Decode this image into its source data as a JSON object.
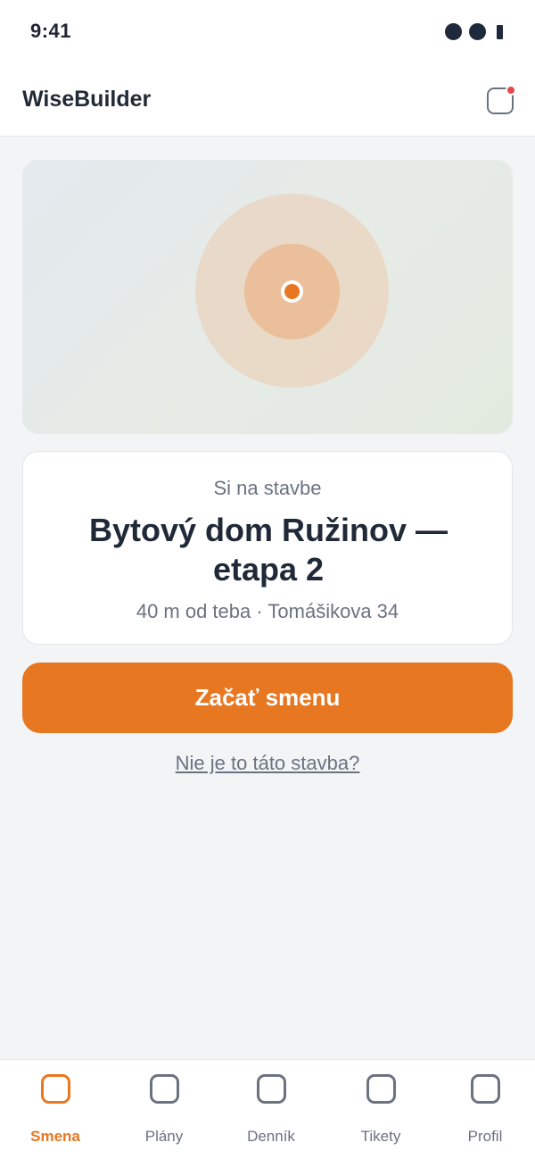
{
  "status_bar": {
    "time": "9:41"
  },
  "header": {
    "title": "WiseBuilder"
  },
  "site_card": {
    "status": "Si na stavbe",
    "name": "Bytový dom Ružinov — etapa 2",
    "meta": "40 m od teba · Tomášikova 34"
  },
  "actions": {
    "start_label": "Začať smenu",
    "wrong_site_label": "Nie je to táto stavba?"
  },
  "nav": {
    "items": [
      {
        "label": "Smena",
        "active": true
      },
      {
        "label": "Plány",
        "active": false
      },
      {
        "label": "Denník",
        "active": false
      },
      {
        "label": "Tikety",
        "active": false
      },
      {
        "label": "Profil",
        "active": false
      }
    ]
  },
  "colors": {
    "accent": "#e87722",
    "notification_badge": "#e5484d",
    "text_primary": "#1f2937",
    "text_secondary": "#6b7280"
  }
}
